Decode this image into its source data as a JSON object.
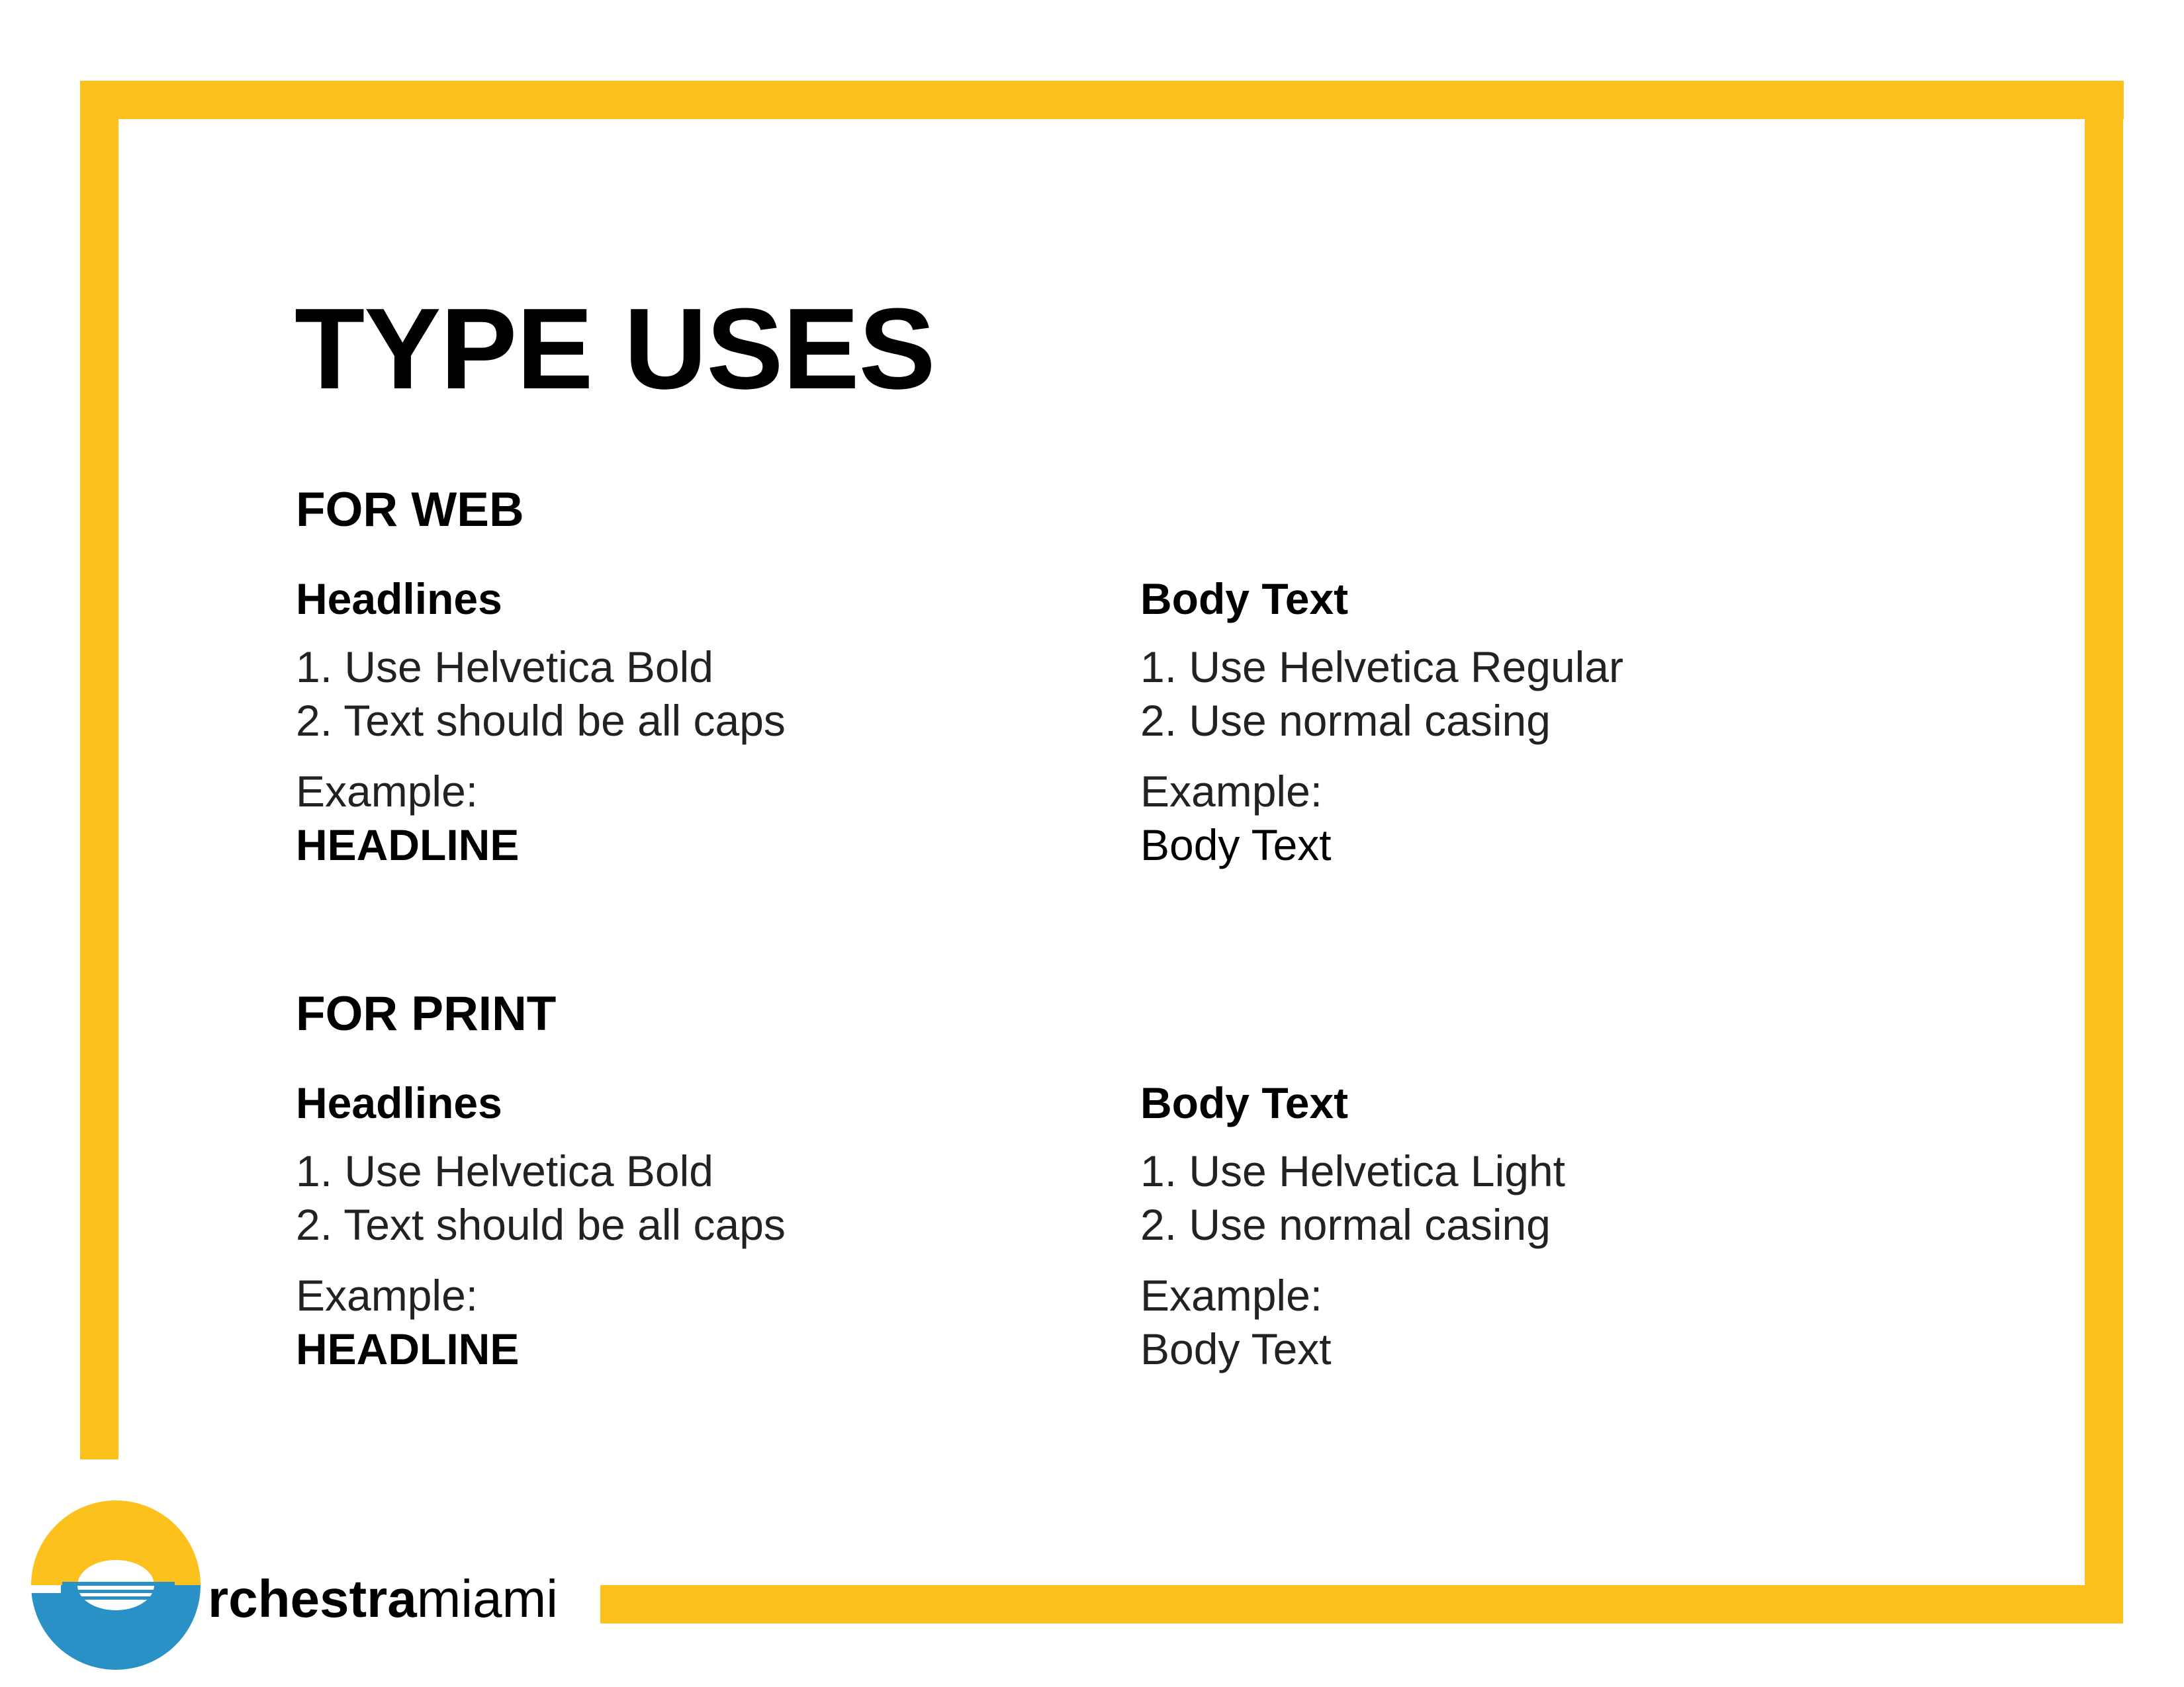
{
  "page": {
    "title": "TYPE USES",
    "accent_color": "#FDC11D"
  },
  "web": {
    "heading": "FOR WEB",
    "headlines": {
      "heading": "Headlines",
      "rule_1": "1. Use Helvetica Bold",
      "rule_2": "2. Text should be all caps",
      "example_label": "Example:",
      "example_value": "HEADLINE"
    },
    "body_text": {
      "heading": "Body Text",
      "rule_1": "1. Use Helvetica Regular",
      "rule_2": "2. Use normal casing",
      "example_label": "Example:",
      "example_value": "Body Text"
    }
  },
  "print": {
    "heading": "FOR PRINT",
    "headlines": {
      "heading": "Headlines",
      "rule_1": "1. Use Helvetica Bold",
      "rule_2": "2. Text should be all caps",
      "example_label": "Example:",
      "example_value": "HEADLINE"
    },
    "body_text": {
      "heading": "Body Text",
      "rule_1": "1. Use Helvetica Light",
      "rule_2": "2. Use normal casing",
      "example_label": "Example:",
      "example_value": "Body Text"
    }
  },
  "logo": {
    "word_bold": "rchestra",
    "word_regular": "miami",
    "icon": "orchestra-miami-logo-icon",
    "colors": {
      "yellow": "#FDC11D",
      "blue": "#2A91C6"
    }
  }
}
